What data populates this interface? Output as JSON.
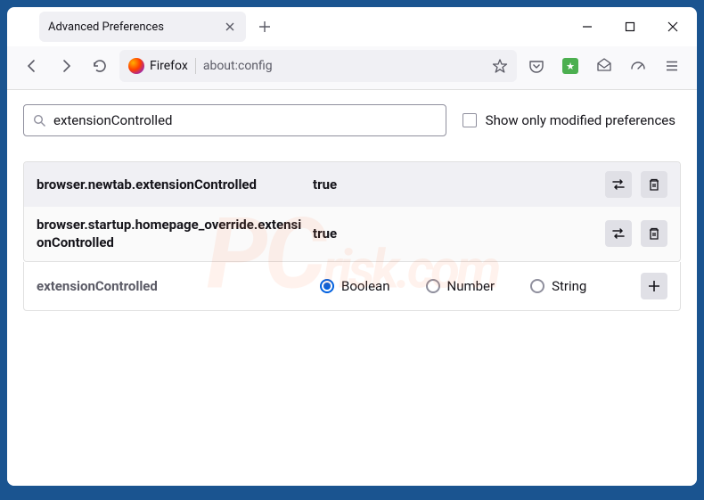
{
  "titlebar": {
    "tab_title": "Advanced Preferences"
  },
  "toolbar": {
    "identity_label": "Firefox",
    "url": "about:config"
  },
  "search": {
    "value": "extensionControlled",
    "filter_label": "Show only modified preferences"
  },
  "prefs": [
    {
      "name": "browser.newtab.extensionControlled",
      "value": "true"
    },
    {
      "name": "browser.startup.homepage_override.extensionControlled",
      "value": "true"
    }
  ],
  "newpref": {
    "name": "extensionControlled",
    "types": [
      "Boolean",
      "Number",
      "String"
    ],
    "selected": "Boolean"
  },
  "watermark": {
    "pc": "PC",
    "risk": "risk.com"
  }
}
